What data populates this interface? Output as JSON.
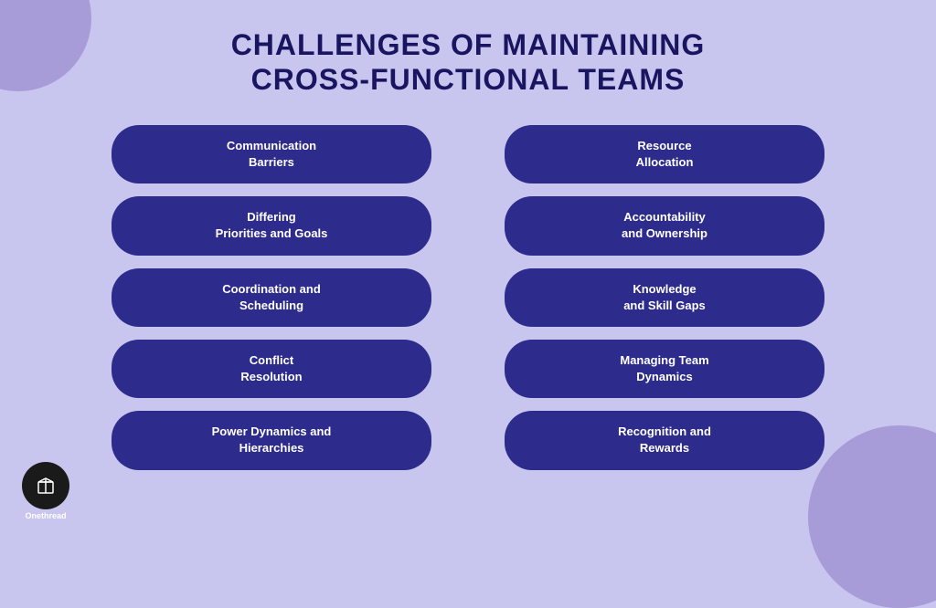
{
  "page": {
    "background_color": "#c8c5ef",
    "title_line1": "CHALLENGES OF MAINTAINING",
    "title_line2": "CROSS-FUNCTIONAL TEAMS"
  },
  "cards": {
    "left": [
      {
        "id": "communication-barriers",
        "label": "Communication\nBarriers"
      },
      {
        "id": "differing-priorities",
        "label": "Differing\nPriorities and Goals"
      },
      {
        "id": "coordination-scheduling",
        "label": "Coordination and\nScheduling"
      },
      {
        "id": "conflict-resolution",
        "label": "Conflict\nResolution"
      },
      {
        "id": "power-dynamics",
        "label": "Power Dynamics and\nHierarchies"
      }
    ],
    "right": [
      {
        "id": "resource-allocation",
        "label": "Resource\nAllocation"
      },
      {
        "id": "accountability-ownership",
        "label": "Accountability\nand Ownership"
      },
      {
        "id": "knowledge-skill-gaps",
        "label": "Knowledge\nand Skill Gaps"
      },
      {
        "id": "managing-team-dynamics",
        "label": "Managing Team\nDynamics"
      },
      {
        "id": "recognition-rewards",
        "label": "Recognition and\nRewards"
      }
    ]
  },
  "logo": {
    "brand": "Onethread"
  },
  "colors": {
    "background": "#c8c5ef",
    "card_bg": "#2d2b8c",
    "title_color": "#1a1560",
    "decoration": "#a89cd8"
  }
}
